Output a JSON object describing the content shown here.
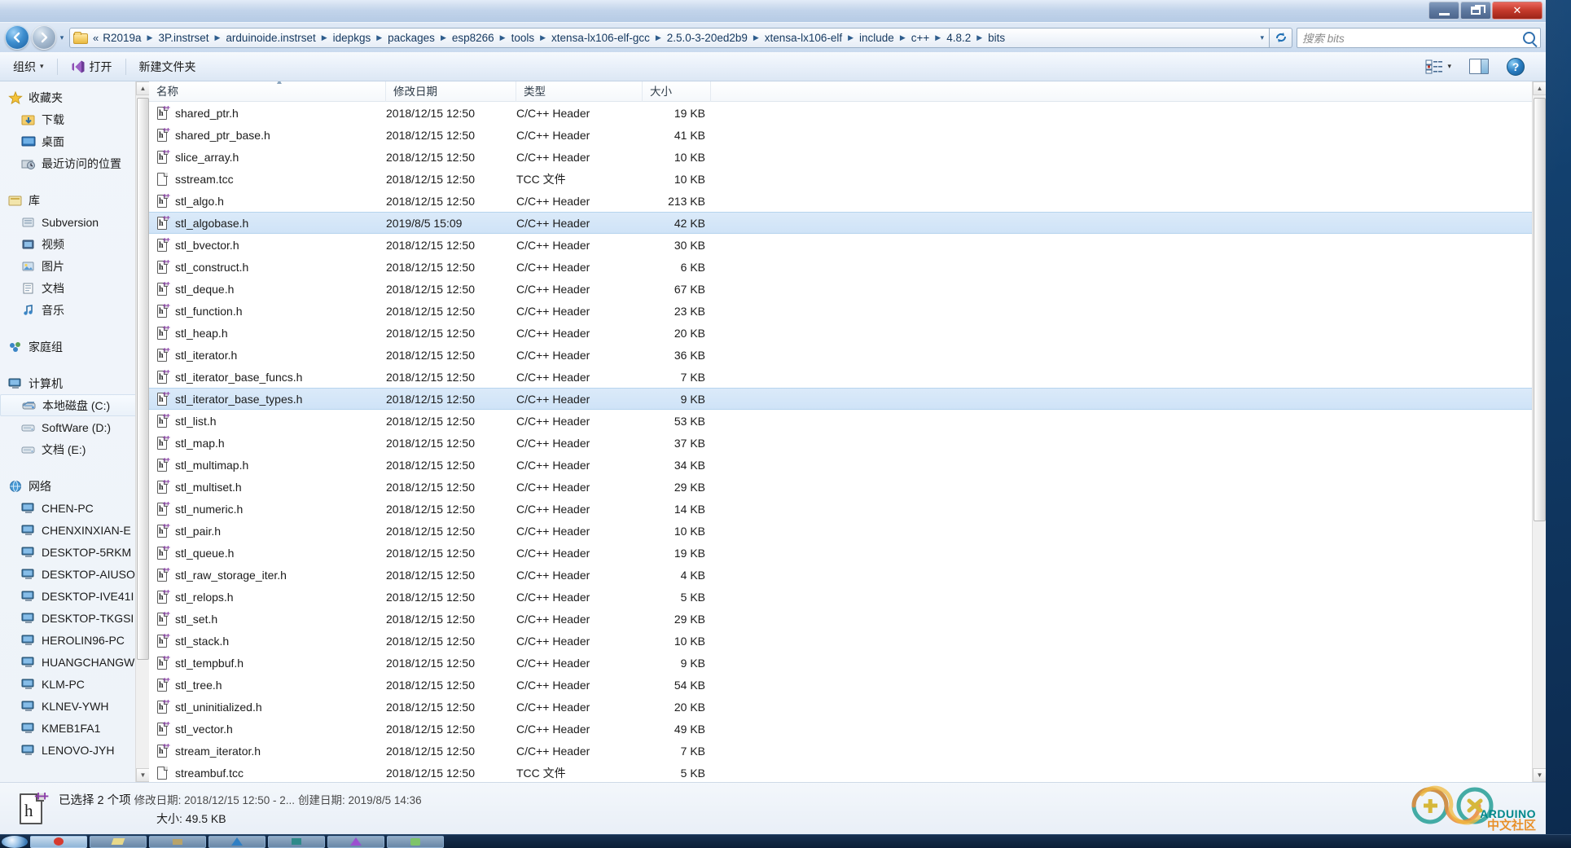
{
  "window": {
    "buttons": {
      "minimize": "—",
      "maximize": "❐",
      "close": "✕"
    }
  },
  "nav": {
    "back_label": "◀",
    "forward_label": "▶",
    "dropdown_label": "▾",
    "crumb_prefix": "«",
    "breadcrumbs": [
      "R2019a",
      "3P.instrset",
      "arduinoide.instrset",
      "idepkgs",
      "packages",
      "esp8266",
      "tools",
      "xtensa-lx106-elf-gcc",
      "2.5.0-3-20ed2b9",
      "xtensa-lx106-elf",
      "include",
      "c++",
      "4.8.2",
      "bits"
    ],
    "address_caret": "▾",
    "refresh_label": "↻"
  },
  "search": {
    "placeholder": "搜索 bits",
    "value": ""
  },
  "toolbar": {
    "organize_label": "组织",
    "organize_caret": "▾",
    "open_label": "打开",
    "new_folder_label": "新建文件夹",
    "view_caret": "▾"
  },
  "navpane": {
    "groups": [
      {
        "name": "收藏夹",
        "icon": "star-icon",
        "items": [
          {
            "label": "下载",
            "icon": "downloads-icon"
          },
          {
            "label": "桌面",
            "icon": "desktop-icon"
          },
          {
            "label": "最近访问的位置",
            "icon": "recent-places-icon"
          }
        ]
      },
      {
        "name": "库",
        "icon": "library-icon",
        "items": [
          {
            "label": "Subversion",
            "icon": "library-folder-icon"
          },
          {
            "label": "视频",
            "icon": "video-library-icon"
          },
          {
            "label": "图片",
            "icon": "pictures-library-icon"
          },
          {
            "label": "文档",
            "icon": "documents-library-icon"
          },
          {
            "label": "音乐",
            "icon": "music-library-icon"
          }
        ]
      },
      {
        "name": "家庭组",
        "icon": "homegroup-icon",
        "items": []
      },
      {
        "name": "计算机",
        "icon": "computer-icon",
        "items": [
          {
            "label": "本地磁盘 (C:)",
            "icon": "system-drive-icon",
            "selected": true
          },
          {
            "label": "SoftWare (D:)",
            "icon": "drive-icon"
          },
          {
            "label": "文档 (E:)",
            "icon": "drive-icon"
          }
        ]
      },
      {
        "name": "网络",
        "icon": "network-icon",
        "items": [
          {
            "label": "CHEN-PC",
            "icon": "network-computer-icon"
          },
          {
            "label": "CHENXINXIAN-E",
            "icon": "network-computer-icon"
          },
          {
            "label": "DESKTOP-5RKM",
            "icon": "network-computer-icon"
          },
          {
            "label": "DESKTOP-AIUSO",
            "icon": "network-computer-icon"
          },
          {
            "label": "DESKTOP-IVE41I",
            "icon": "network-computer-icon"
          },
          {
            "label": "DESKTOP-TKGSI",
            "icon": "network-computer-icon"
          },
          {
            "label": "HEROLIN96-PC",
            "icon": "network-computer-icon"
          },
          {
            "label": "HUANGCHANGW",
            "icon": "network-computer-icon"
          },
          {
            "label": "KLM-PC",
            "icon": "network-computer-icon"
          },
          {
            "label": "KLNEV-YWH",
            "icon": "network-computer-icon"
          },
          {
            "label": "KMEB1FA1",
            "icon": "network-computer-icon"
          },
          {
            "label": "LENOVO-JYH",
            "icon": "network-computer-icon"
          }
        ]
      }
    ]
  },
  "filelist": {
    "columns": [
      "名称",
      "修改日期",
      "类型",
      "大小"
    ],
    "sort_indicator": "▲",
    "rows": [
      {
        "name": "shared_ptr.h",
        "date": "2018/12/15 12:50",
        "type": "C/C++ Header",
        "size": "19 KB",
        "icon": "header-file-icon",
        "selected": false
      },
      {
        "name": "shared_ptr_base.h",
        "date": "2018/12/15 12:50",
        "type": "C/C++ Header",
        "size": "41 KB",
        "icon": "header-file-icon",
        "selected": false
      },
      {
        "name": "slice_array.h",
        "date": "2018/12/15 12:50",
        "type": "C/C++ Header",
        "size": "10 KB",
        "icon": "header-file-icon",
        "selected": false
      },
      {
        "name": "sstream.tcc",
        "date": "2018/12/15 12:50",
        "type": "TCC 文件",
        "size": "10 KB",
        "icon": "generic-file-icon",
        "selected": false
      },
      {
        "name": "stl_algo.h",
        "date": "2018/12/15 12:50",
        "type": "C/C++ Header",
        "size": "213 KB",
        "icon": "header-file-icon",
        "selected": false
      },
      {
        "name": "stl_algobase.h",
        "date": "2019/8/5 15:09",
        "type": "C/C++ Header",
        "size": "42 KB",
        "icon": "header-file-icon",
        "selected": true
      },
      {
        "name": "stl_bvector.h",
        "date": "2018/12/15 12:50",
        "type": "C/C++ Header",
        "size": "30 KB",
        "icon": "header-file-icon",
        "selected": false
      },
      {
        "name": "stl_construct.h",
        "date": "2018/12/15 12:50",
        "type": "C/C++ Header",
        "size": "6 KB",
        "icon": "header-file-icon",
        "selected": false
      },
      {
        "name": "stl_deque.h",
        "date": "2018/12/15 12:50",
        "type": "C/C++ Header",
        "size": "67 KB",
        "icon": "header-file-icon",
        "selected": false
      },
      {
        "name": "stl_function.h",
        "date": "2018/12/15 12:50",
        "type": "C/C++ Header",
        "size": "23 KB",
        "icon": "header-file-icon",
        "selected": false
      },
      {
        "name": "stl_heap.h",
        "date": "2018/12/15 12:50",
        "type": "C/C++ Header",
        "size": "20 KB",
        "icon": "header-file-icon",
        "selected": false
      },
      {
        "name": "stl_iterator.h",
        "date": "2018/12/15 12:50",
        "type": "C/C++ Header",
        "size": "36 KB",
        "icon": "header-file-icon",
        "selected": false
      },
      {
        "name": "stl_iterator_base_funcs.h",
        "date": "2018/12/15 12:50",
        "type": "C/C++ Header",
        "size": "7 KB",
        "icon": "header-file-icon",
        "selected": false
      },
      {
        "name": "stl_iterator_base_types.h",
        "date": "2018/12/15 12:50",
        "type": "C/C++ Header",
        "size": "9 KB",
        "icon": "header-file-icon",
        "selected": true
      },
      {
        "name": "stl_list.h",
        "date": "2018/12/15 12:50",
        "type": "C/C++ Header",
        "size": "53 KB",
        "icon": "header-file-icon",
        "selected": false
      },
      {
        "name": "stl_map.h",
        "date": "2018/12/15 12:50",
        "type": "C/C++ Header",
        "size": "37 KB",
        "icon": "header-file-icon",
        "selected": false
      },
      {
        "name": "stl_multimap.h",
        "date": "2018/12/15 12:50",
        "type": "C/C++ Header",
        "size": "34 KB",
        "icon": "header-file-icon",
        "selected": false
      },
      {
        "name": "stl_multiset.h",
        "date": "2018/12/15 12:50",
        "type": "C/C++ Header",
        "size": "29 KB",
        "icon": "header-file-icon",
        "selected": false
      },
      {
        "name": "stl_numeric.h",
        "date": "2018/12/15 12:50",
        "type": "C/C++ Header",
        "size": "14 KB",
        "icon": "header-file-icon",
        "selected": false
      },
      {
        "name": "stl_pair.h",
        "date": "2018/12/15 12:50",
        "type": "C/C++ Header",
        "size": "10 KB",
        "icon": "header-file-icon",
        "selected": false
      },
      {
        "name": "stl_queue.h",
        "date": "2018/12/15 12:50",
        "type": "C/C++ Header",
        "size": "19 KB",
        "icon": "header-file-icon",
        "selected": false
      },
      {
        "name": "stl_raw_storage_iter.h",
        "date": "2018/12/15 12:50",
        "type": "C/C++ Header",
        "size": "4 KB",
        "icon": "header-file-icon",
        "selected": false
      },
      {
        "name": "stl_relops.h",
        "date": "2018/12/15 12:50",
        "type": "C/C++ Header",
        "size": "5 KB",
        "icon": "header-file-icon",
        "selected": false
      },
      {
        "name": "stl_set.h",
        "date": "2018/12/15 12:50",
        "type": "C/C++ Header",
        "size": "29 KB",
        "icon": "header-file-icon",
        "selected": false
      },
      {
        "name": "stl_stack.h",
        "date": "2018/12/15 12:50",
        "type": "C/C++ Header",
        "size": "10 KB",
        "icon": "header-file-icon",
        "selected": false
      },
      {
        "name": "stl_tempbuf.h",
        "date": "2018/12/15 12:50",
        "type": "C/C++ Header",
        "size": "9 KB",
        "icon": "header-file-icon",
        "selected": false
      },
      {
        "name": "stl_tree.h",
        "date": "2018/12/15 12:50",
        "type": "C/C++ Header",
        "size": "54 KB",
        "icon": "header-file-icon",
        "selected": false
      },
      {
        "name": "stl_uninitialized.h",
        "date": "2018/12/15 12:50",
        "type": "C/C++ Header",
        "size": "20 KB",
        "icon": "header-file-icon",
        "selected": false
      },
      {
        "name": "stl_vector.h",
        "date": "2018/12/15 12:50",
        "type": "C/C++ Header",
        "size": "49 KB",
        "icon": "header-file-icon",
        "selected": false
      },
      {
        "name": "stream_iterator.h",
        "date": "2018/12/15 12:50",
        "type": "C/C++ Header",
        "size": "7 KB",
        "icon": "header-file-icon",
        "selected": false
      },
      {
        "name": "streambuf.tcc",
        "date": "2018/12/15 12:50",
        "type": "TCC 文件",
        "size": "5 KB",
        "icon": "generic-file-icon",
        "selected": false
      }
    ]
  },
  "statusbar": {
    "selection": "已选择 2 个项",
    "modified": "修改日期: 2018/12/15 12:50 - 2...",
    "created": "创建日期: 2019/8/5 14:36",
    "size": "大小: 49.5 KB"
  },
  "watermark": {
    "line1": "ARDUINO",
    "line2": "中文社区"
  },
  "colors": {
    "selection_blue": "#cfe3f7",
    "accent": "#1f6fb4",
    "close_red": "#c63a2c",
    "arduino_teal": "#00888a",
    "arduino_orange": "#e8902a"
  }
}
